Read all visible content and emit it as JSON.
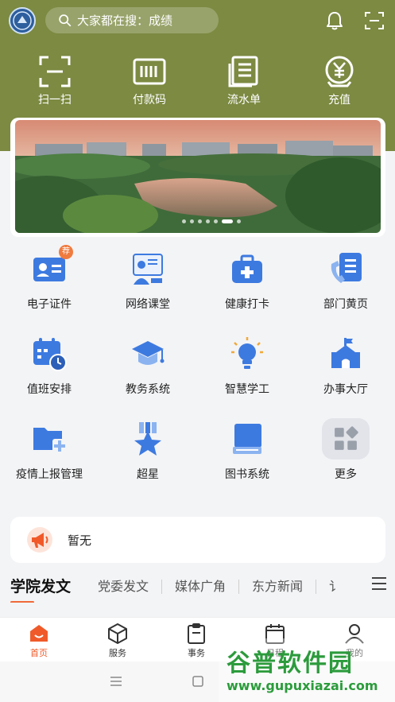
{
  "search": {
    "placeholder_text": "大家都在搜：成绩"
  },
  "quick_actions": [
    {
      "label": "扫一扫",
      "icon": "scan-icon"
    },
    {
      "label": "付款码",
      "icon": "barcode-icon"
    },
    {
      "label": "流水单",
      "icon": "receipt-icon"
    },
    {
      "label": "充值",
      "icon": "yuan-recharge-icon"
    }
  ],
  "banner": {
    "slide_count": 7,
    "active_slide": 6
  },
  "services": [
    {
      "label": "电子证件",
      "icon": "id-card-icon",
      "badge": "荐"
    },
    {
      "label": "网络课堂",
      "icon": "online-class-icon"
    },
    {
      "label": "健康打卡",
      "icon": "medical-kit-icon"
    },
    {
      "label": "部门黄页",
      "icon": "phone-directory-icon"
    },
    {
      "label": "值班安排",
      "icon": "calendar-clock-icon"
    },
    {
      "label": "教务系统",
      "icon": "graduation-cap-icon"
    },
    {
      "label": "智慧学工",
      "icon": "lightbulb-icon"
    },
    {
      "label": "办事大厅",
      "icon": "building-icon"
    },
    {
      "label": "疫情上报管理",
      "icon": "folder-add-icon"
    },
    {
      "label": "超星",
      "icon": "star-medal-icon"
    },
    {
      "label": "图书系统",
      "icon": "book-icon"
    },
    {
      "label": "更多",
      "icon": "grid-more-icon"
    }
  ],
  "notice": {
    "text": "暂无"
  },
  "news_tabs": [
    "学院发文",
    "党委发文",
    "媒体广角",
    "东方新闻",
    "讠"
  ],
  "tabbar": [
    {
      "label": "首页",
      "icon": "home-icon",
      "active": true
    },
    {
      "label": "服务",
      "icon": "cube-icon"
    },
    {
      "label": "事务",
      "icon": "clipboard-icon"
    },
    {
      "label": "日程",
      "icon": "calendar-icon"
    },
    {
      "label": "我的",
      "icon": "user-icon"
    }
  ],
  "watermark": {
    "title": "谷普软件园",
    "url": "www.gupuxiazai.com"
  },
  "colors": {
    "header": "#7c8a42",
    "accent": "#f05a2a",
    "icon_blue": "#3d7ae0"
  }
}
